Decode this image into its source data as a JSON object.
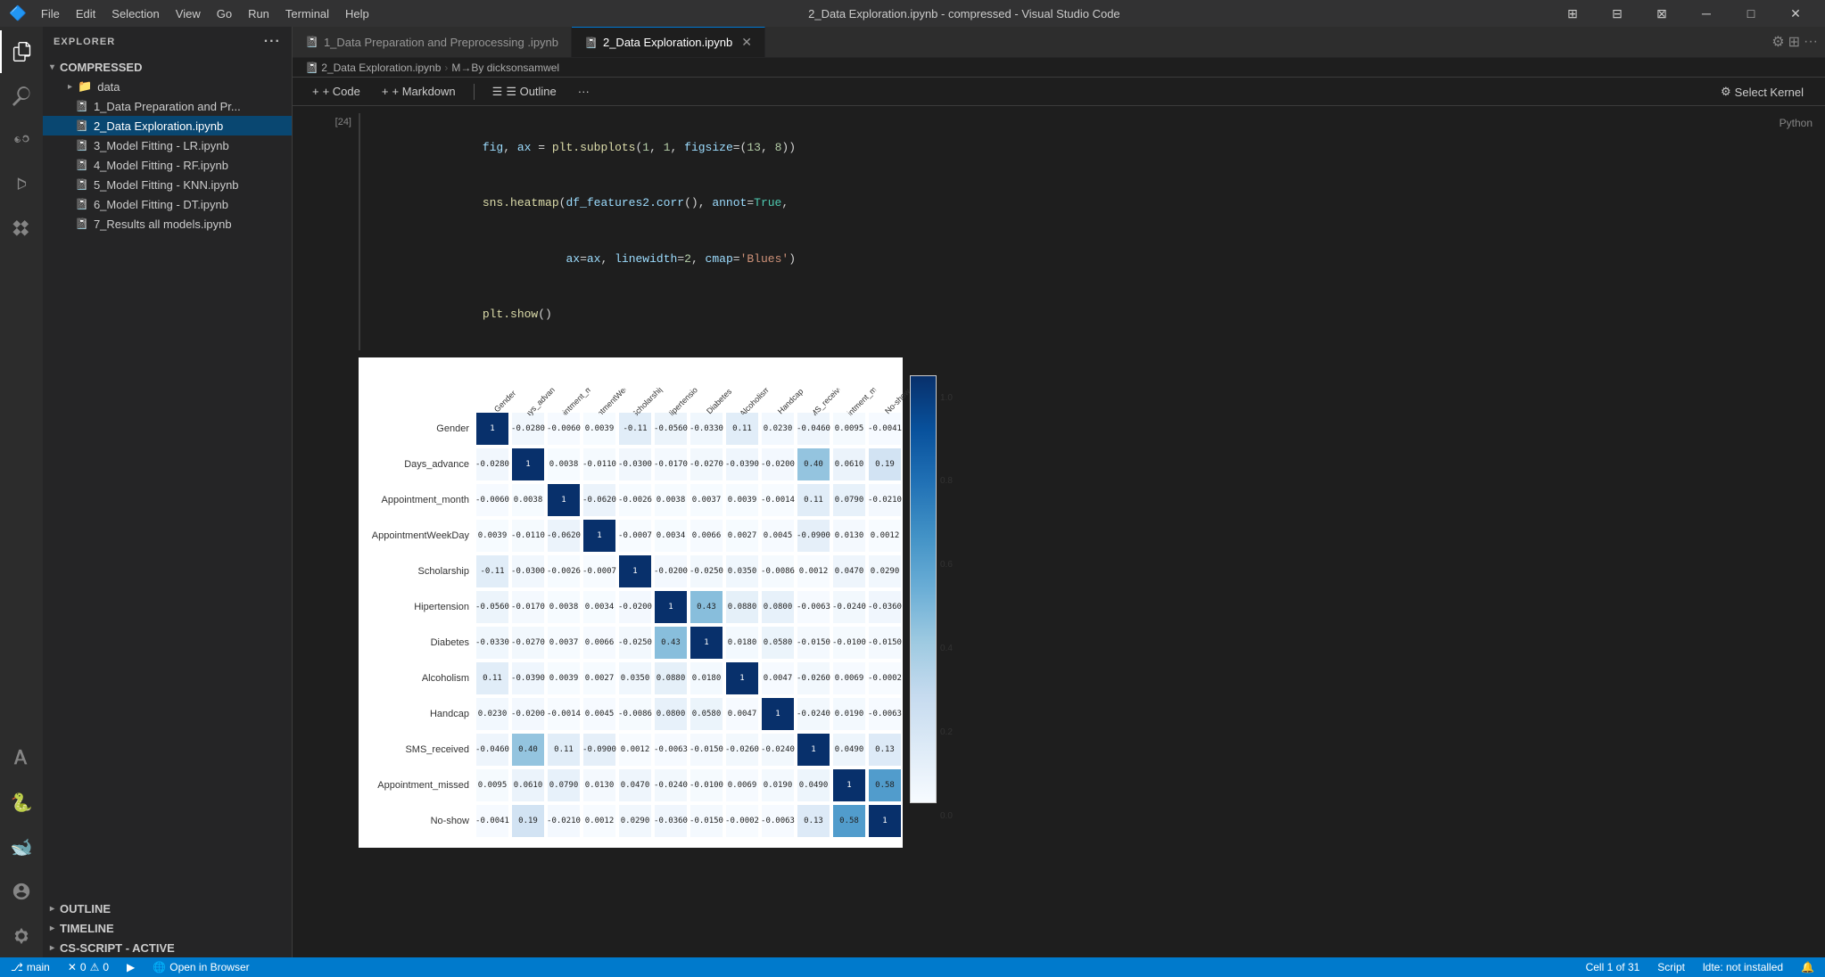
{
  "titlebar": {
    "title": "2_Data Exploration.ipynb - compressed - Visual Studio Code",
    "menu_items": [
      "File",
      "Edit",
      "Selection",
      "View",
      "Go",
      "Run",
      "Terminal",
      "Help"
    ]
  },
  "sidebar": {
    "header": "EXPLORER",
    "root_folder": "COMPRESSED",
    "items": [
      {
        "label": "data",
        "type": "folder",
        "icon": "folder"
      },
      {
        "label": "1_Data Preparation and Pr...",
        "type": "file",
        "icon": "nb"
      },
      {
        "label": "2_Data Exploration.ipynb",
        "type": "file",
        "icon": "nb",
        "active": true
      },
      {
        "label": "3_Model Fitting - LR.ipynb",
        "type": "file",
        "icon": "nb"
      },
      {
        "label": "4_Model Fitting - RF.ipynb",
        "type": "file",
        "icon": "nb"
      },
      {
        "label": "5_Model Fitting - KNN.ipynb",
        "type": "file",
        "icon": "nb"
      },
      {
        "label": "6_Model Fitting - DT.ipynb",
        "type": "file",
        "icon": "nb"
      },
      {
        "label": "7_Results all models.ipynb",
        "type": "file",
        "icon": "nb"
      }
    ],
    "outline_label": "OUTLINE",
    "timeline_label": "TIMELINE",
    "csscript_label": "CS-SCRIPT - ACTIVE"
  },
  "tabs": [
    {
      "label": "1_Data Preparation and Preprocessing .ipynb",
      "active": false,
      "closable": false
    },
    {
      "label": "2_Data Exploration.ipynb",
      "active": true,
      "closable": true
    }
  ],
  "breadcrumb": {
    "file": "2_Data Exploration.ipynb",
    "separator": "›",
    "section": "M→By dicksonsamwel"
  },
  "toolbar": {
    "code_label": "+ Code",
    "markdown_label": "+ Markdown",
    "outline_label": "☰ Outline",
    "more_label": "···"
  },
  "cell": {
    "number": "[24]",
    "code_lines": [
      "fig, ax = plt.subplots(1, 1, figsize=(13, 8))",
      "sns.heatmap(df_features2.corr(), annot=True,",
      "            ax=ax, linewidth=2, cmap='Blues')",
      "plt.show()"
    ],
    "language": "Python"
  },
  "heatmap": {
    "labels": [
      "Gender",
      "Days_advance",
      "Appointment_month",
      "AppointmentWeekDay",
      "Scholarship",
      "Hipertension",
      "Diabetes",
      "Alcoholism",
      "Handcap",
      "SMS_received",
      "Appointment_missed",
      "No-show"
    ],
    "colorbar_labels": [
      "1.0",
      "0.8",
      "0.6",
      "0.4",
      "0.2",
      "0.0"
    ],
    "data": [
      [
        1,
        -0.028,
        -0.006,
        0.0039,
        -0.11,
        -0.056,
        -0.033,
        0.11,
        0.023,
        -0.046,
        0.0095,
        -0.0041
      ],
      [
        -0.028,
        1,
        0.0038,
        -0.011,
        -0.03,
        -0.017,
        -0.027,
        -0.039,
        -0.02,
        0.4,
        0.061,
        0.19
      ],
      [
        -0.006,
        0.0038,
        1,
        -0.062,
        -0.0026,
        0.0038,
        0.0037,
        0.0039,
        -0.0014,
        0.11,
        0.079,
        -0.021
      ],
      [
        0.0039,
        -0.011,
        -0.062,
        1,
        -0.00068,
        0.0034,
        0.0066,
        0.0027,
        0.0045,
        -0.09,
        0.013,
        0.0012
      ],
      [
        -0.11,
        -0.03,
        -0.0026,
        -0.00068,
        1,
        -0.02,
        -0.025,
        0.035,
        -0.0086,
        0.0012,
        0.047,
        0.029
      ],
      [
        -0.056,
        -0.017,
        0.0038,
        0.0034,
        -0.02,
        1,
        0.43,
        0.088,
        0.08,
        -0.0063,
        -0.024,
        -0.036
      ],
      [
        -0.033,
        -0.027,
        0.0037,
        0.0066,
        -0.025,
        0.43,
        1,
        0.018,
        0.058,
        -0.015,
        -0.01,
        -0.015
      ],
      [
        0.11,
        -0.039,
        0.0039,
        0.0027,
        0.035,
        0.088,
        0.018,
        1,
        0.0047,
        -0.026,
        0.0069,
        -0.00018
      ],
      [
        0.023,
        -0.02,
        -0.0014,
        0.0045,
        -0.0086,
        0.08,
        0.058,
        0.0047,
        1,
        -0.024,
        0.019,
        -0.0063
      ],
      [
        -0.046,
        0.4,
        0.11,
        -0.09,
        0.0012,
        -0.0063,
        -0.015,
        -0.026,
        -0.024,
        1,
        0.049,
        0.13
      ],
      [
        0.0095,
        0.061,
        0.079,
        0.013,
        0.047,
        -0.024,
        -0.01,
        0.0069,
        0.019,
        0.049,
        1,
        0.58
      ],
      [
        -0.0041,
        0.19,
        -0.021,
        0.0012,
        0.029,
        -0.036,
        -0.015,
        -0.00018,
        -0.0063,
        0.13,
        0.58,
        1
      ]
    ]
  },
  "status": {
    "errors": "0",
    "warnings": "0",
    "run_icon": "▶",
    "browser_label": "Open in Browser",
    "cell_info": "Cell 1 of 31",
    "language": "Script",
    "kernel_status": "ldte: not installed"
  },
  "kernel": {
    "label": "Select Kernel"
  }
}
